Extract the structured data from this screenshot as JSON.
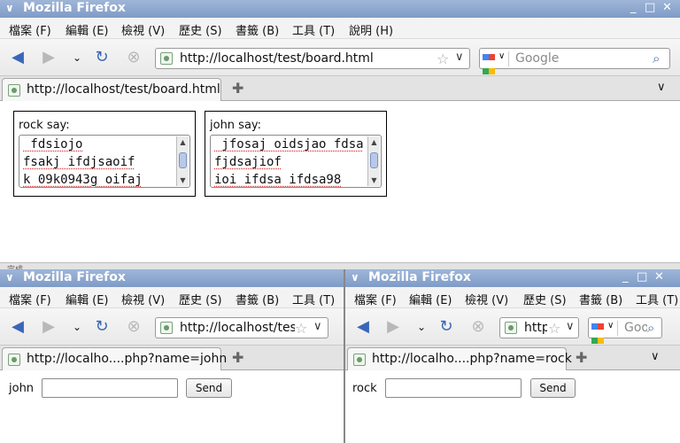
{
  "app_title": "Mozilla Firefox",
  "menus": [
    "檔案 (F)",
    "編輯 (E)",
    "檢視 (V)",
    "歷史 (S)",
    "書籤 (B)",
    "工具 (T)",
    "說明 (H)"
  ],
  "window_controls": [
    "_",
    "□",
    "✕"
  ],
  "search_placeholder": "Google",
  "status_text": "完成",
  "windows": {
    "main": {
      "url": "http://localhost/test/board.html",
      "tab_title": "http://localhost/test/board.html",
      "boards": [
        {
          "speaker": "rock say:",
          "messages": [
            " fdsiojo",
            "fsakj ifdjsaoif",
            "k 09k0943g oifaj"
          ]
        },
        {
          "speaker": "john say:",
          "messages": [
            " jfosaj oidsjao fdsa",
            "fjdsajiof",
            "ioi ifdsa ifdsa98"
          ]
        }
      ]
    },
    "john": {
      "url": "http://localhost/test",
      "tab_title": "http://localho....php?name=john",
      "form": {
        "name_label": "john",
        "message_value": "",
        "send_label": "Send"
      }
    },
    "rock": {
      "url": "http://",
      "tab_title": "http://localho....php?name=rock",
      "search_placeholder": "Goo",
      "form": {
        "name_label": "rock",
        "message_value": "",
        "send_label": "Send"
      }
    }
  }
}
